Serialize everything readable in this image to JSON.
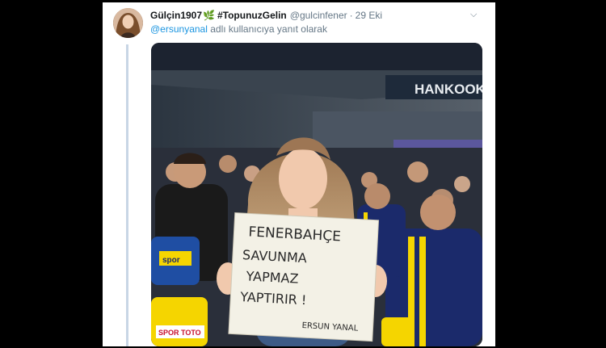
{
  "tweet": {
    "display_name": "Gülçin1907",
    "hashtag": "#TopunuzGelin",
    "handle": "@gulcinfener",
    "separator": "·",
    "date": "29 Eki",
    "reply_to_handle": "@ersunyanal",
    "reply_suffix": " adlı kullanıcıya yanıt olarak",
    "icons": {
      "leaf": "leaf-icon",
      "caret": "chevron-down-icon"
    }
  },
  "photo": {
    "banner_text": "HANKOOK",
    "seat_text_1": "spor",
    "seat_text_2": "SPOR TOTO",
    "sign": {
      "line1": "FENERBAHÇE",
      "line2": "SAVUNMA",
      "line3": "YAPMAZ",
      "line4": "YAPTIRIR !",
      "signature": "ERSUN YANAL"
    }
  },
  "colors": {
    "background": "#000000",
    "card": "#ffffff",
    "link": "#1b95e0",
    "muted": "#657786",
    "fenerbahce_navy": "#1b2a6b",
    "fenerbahce_yellow": "#f5d500"
  }
}
